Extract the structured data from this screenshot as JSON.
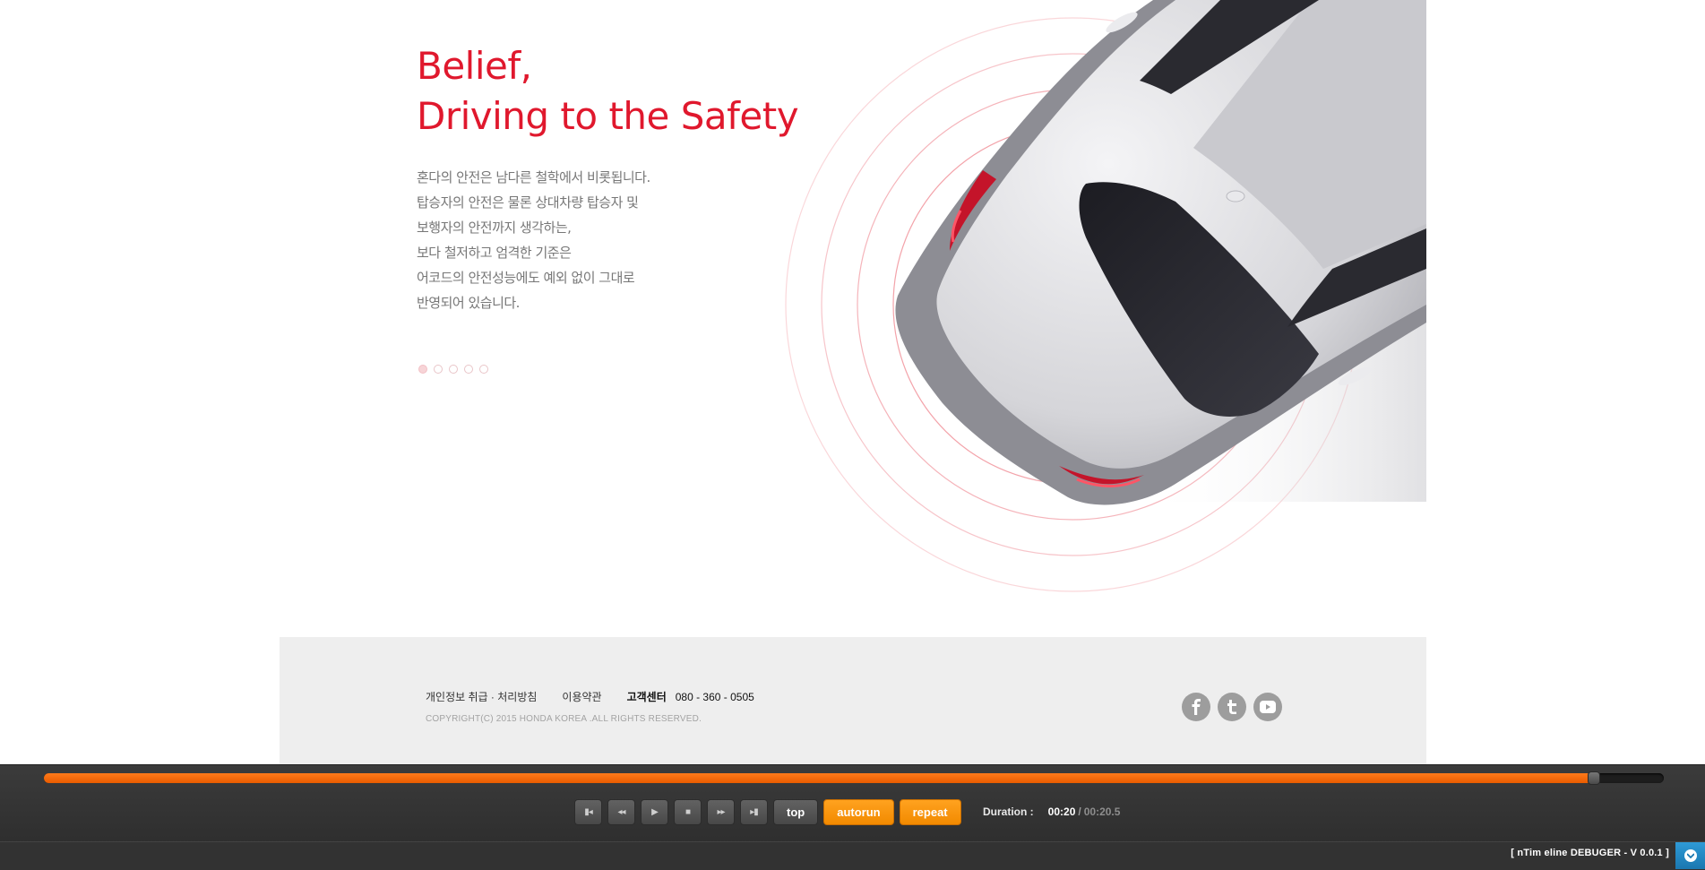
{
  "hero": {
    "headline_line1": "Belief,",
    "headline_line2": "Driving to the Safety",
    "body_lines": [
      "혼다의 안전은 남다른 철학에서 비롯됩니다.",
      "탑승자의 안전은 물론 상대차량 탑승자 및",
      "보행자의 안전까지 생각하는,",
      "보다 철저하고 엄격한 기준은",
      "어코드의 안전성능에도 예외 없이 그대로",
      "반영되어 있습니다."
    ],
    "pager": {
      "count": 5,
      "active_index": 0
    },
    "accent_color": "#e0182d"
  },
  "footer": {
    "privacy_link": "개인정보 취급 · 처리방침",
    "terms_link": "이용약관",
    "customer_center_label": "고객센터",
    "customer_center_phone": "080 - 360 - 0505",
    "copyright": "COPYRIGHT(C) 2015 HONDA KOREA .ALL RIGHTS RESERVED.",
    "social": [
      {
        "name": "facebook",
        "icon": "facebook-icon"
      },
      {
        "name": "twitter",
        "icon": "twitter-icon"
      },
      {
        "name": "youtube",
        "icon": "youtube-icon"
      }
    ]
  },
  "debugger": {
    "progress_fraction": 0.957,
    "progress_color": "#f26a0a",
    "buttons": {
      "first": "▮◂",
      "prev": "◂◂",
      "play": "▶",
      "stop": "■",
      "next": "▸▸",
      "last": "▸▮"
    },
    "top_label": "top",
    "autorun_label": "autorun",
    "repeat_label": "repeat",
    "duration_label": "Duration :",
    "current_time": "00:20",
    "separator": "/",
    "total_time": "00:20.5",
    "title": "[ nTim eline DEBUGER - V 0.0.1 ]"
  }
}
